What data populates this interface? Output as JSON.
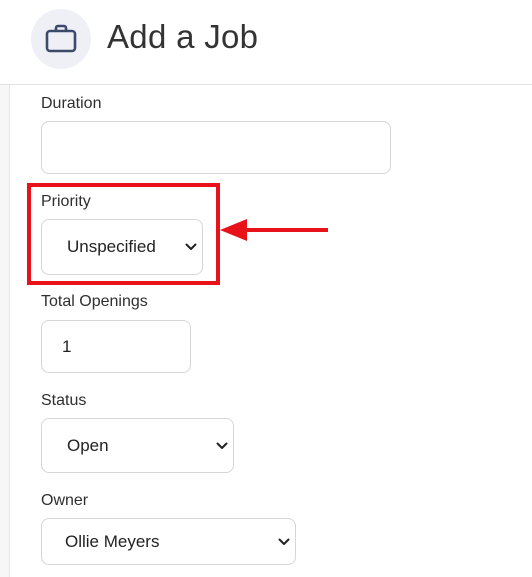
{
  "header": {
    "title": "Add a Job",
    "icon": "briefcase-icon"
  },
  "form": {
    "duration": {
      "label": "Duration",
      "value": ""
    },
    "priority": {
      "label": "Priority",
      "selected": "Unspecified"
    },
    "total_openings": {
      "label": "Total Openings",
      "value": "1"
    },
    "status": {
      "label": "Status",
      "selected": "Open"
    },
    "owner": {
      "label": "Owner",
      "selected": "Ollie Meyers"
    }
  },
  "annotation": {
    "highlight_color": "#e8121b",
    "arrow_color": "#e8121b"
  }
}
